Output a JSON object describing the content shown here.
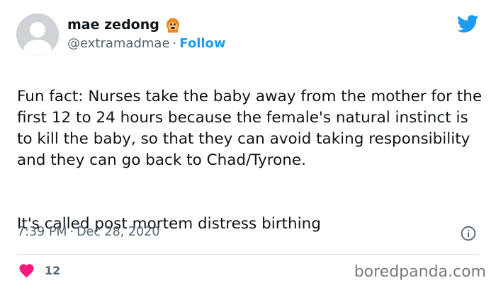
{
  "author": {
    "display_name": "mae zedong",
    "handle": "@extramadmae",
    "follow_label": "Follow",
    "separator": "·"
  },
  "icons": {
    "avatar": "default-avatar",
    "emoji": "monkey-emoji",
    "logo": "twitter-bird-icon",
    "info": "info-icon",
    "like": "heart-icon"
  },
  "tweet": {
    "paragraph_1": "Fun fact: Nurses take the baby away from the mother for the first 12 to 24 hours because the female's natural instinct is to kill the baby, so that they can avoid taking responsibility and they can go back to Chad/Tyrone.",
    "paragraph_2": "It's called post mortem distress birthing",
    "time": "7:39 PM",
    "date": "Dec 28, 2020",
    "separator": "·"
  },
  "engagement": {
    "like_count": "12"
  },
  "watermark": "boredpanda.com",
  "colors": {
    "link": "#1d9bf0",
    "muted": "#536471",
    "heart": "#f91880"
  }
}
